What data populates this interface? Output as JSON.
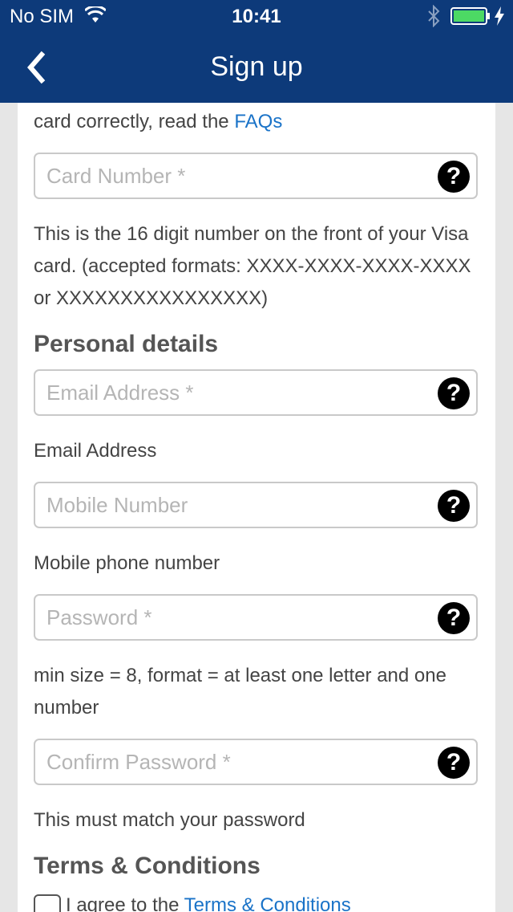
{
  "status_bar": {
    "carrier": "No SIM",
    "time": "10:41"
  },
  "nav": {
    "title": "Sign up"
  },
  "intro": {
    "prefix": "card correctly, read the ",
    "faqs_link": "FAQs"
  },
  "card_number": {
    "placeholder": "Card Number *",
    "help": "?",
    "hint": "This is the 16 digit number on the front of your Visa card. (accepted formats: XXXX-XXXX-XXXX-XXXX or XXXXXXXXXXXXXXXX)"
  },
  "personal_details": {
    "heading": "Personal details"
  },
  "email": {
    "placeholder": "Email Address *",
    "help": "?",
    "hint": "Email Address"
  },
  "mobile": {
    "placeholder": "Mobile Number",
    "help": "?",
    "hint": "Mobile phone number"
  },
  "password": {
    "placeholder": "Password *",
    "help": "?",
    "hint": "min size = 8, format = at least one letter and one number"
  },
  "confirm_password": {
    "placeholder": "Confirm Password *",
    "help": "?",
    "hint": "This must match your password"
  },
  "terms": {
    "heading": "Terms & Conditions",
    "agree_prefix": "I agree to the ",
    "link": "Terms & Conditions"
  }
}
